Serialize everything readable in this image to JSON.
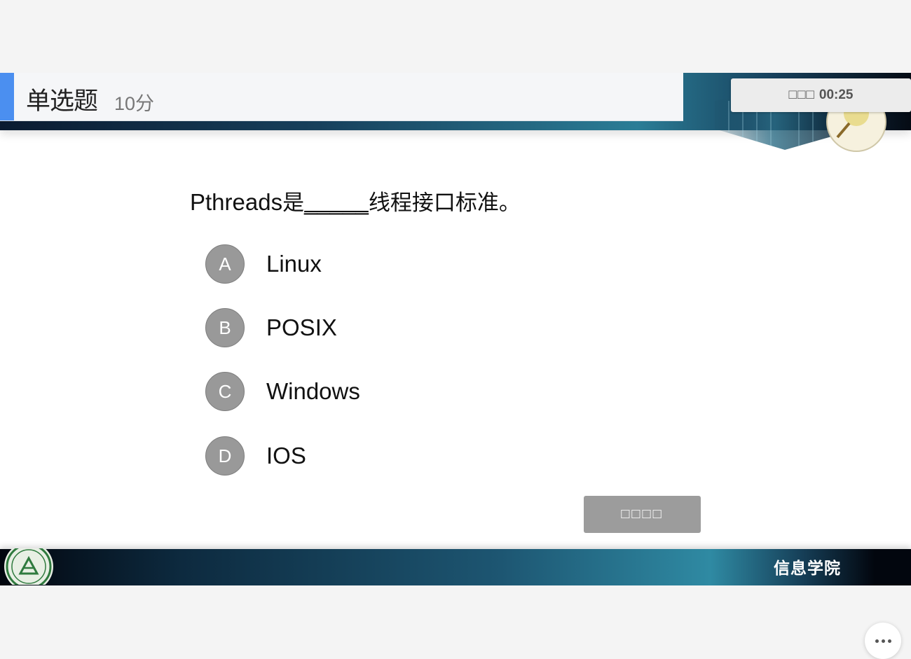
{
  "header": {
    "question_type": "单选题",
    "score": "10分"
  },
  "timer": {
    "label": "□□□",
    "time": "00:25"
  },
  "question": {
    "prefix": "Pthreads",
    "cjk_before": "是",
    "blank": "_____",
    "cjk_after": "线程接口标准。"
  },
  "options": [
    {
      "letter": "A",
      "text": "Linux"
    },
    {
      "letter": "B",
      "text": "POSIX"
    },
    {
      "letter": "C",
      "text": "Windows"
    },
    {
      "letter": "D",
      "text": "IOS"
    }
  ],
  "submit_label": "□□□□",
  "footer": {
    "school_label": "信息学院"
  },
  "colors": {
    "accent": "#4b8ff0",
    "option_circle": "#999999",
    "submit_bg": "#9c9c9c"
  }
}
